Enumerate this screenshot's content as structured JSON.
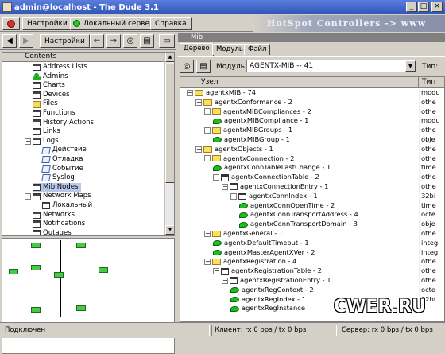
{
  "window": {
    "title": "admin@localhost - The Dude 3.1",
    "min": "_",
    "max": "□",
    "close": "×"
  },
  "menubar": {
    "settings": "Настройки",
    "local_server": "Локальный сервер",
    "help": "Справка",
    "brand": "HotSpot Controllers -> www"
  },
  "left_toolbar": {
    "settings": "Настройки"
  },
  "contents": {
    "header": "Contents",
    "items": [
      {
        "label": "Address Lists",
        "icon": "grid",
        "indent": 1
      },
      {
        "label": "Admins",
        "icon": "man",
        "indent": 1
      },
      {
        "label": "Charts",
        "icon": "grid",
        "indent": 1
      },
      {
        "label": "Devices",
        "icon": "grid",
        "indent": 1
      },
      {
        "label": "Files",
        "icon": "fold",
        "indent": 1
      },
      {
        "label": "Functions",
        "icon": "grid",
        "indent": 1
      },
      {
        "label": "History Actions",
        "icon": "grid",
        "indent": 1
      },
      {
        "label": "Links",
        "icon": "grid",
        "indent": 1
      },
      {
        "label": "Logs",
        "icon": "grid",
        "indent": 0,
        "toggle": "−"
      },
      {
        "label": "Действие",
        "icon": "note",
        "indent": 2
      },
      {
        "label": "Отладка",
        "icon": "note",
        "indent": 2
      },
      {
        "label": "Событие",
        "icon": "note",
        "indent": 2
      },
      {
        "label": "Syslog",
        "icon": "note",
        "indent": 2
      },
      {
        "label": "Mib Nodes",
        "icon": "grid",
        "indent": 1,
        "selected": true
      },
      {
        "label": "Network Maps",
        "icon": "grid",
        "indent": 0,
        "toggle": "−"
      },
      {
        "label": "Локальный",
        "icon": "grid",
        "indent": 2
      },
      {
        "label": "Networks",
        "icon": "grid",
        "indent": 1
      },
      {
        "label": "Notifications",
        "icon": "grid",
        "indent": 1
      },
      {
        "label": "Outages",
        "icon": "grid",
        "indent": 1
      }
    ]
  },
  "mib": {
    "header": "Mib",
    "tabs": [
      "Дерево",
      "Модуль",
      "Файл"
    ],
    "module_label": "Модуль:",
    "module_value": "AGENTX-MIB -- 41",
    "type_label": "Тип:",
    "col_node": "Узел",
    "col_type": "Тип",
    "rows": [
      {
        "name": "agentxMIB - 74",
        "icon": "folder",
        "level": 0,
        "type": "modu"
      },
      {
        "name": "agentxConformance - 2",
        "icon": "folder",
        "level": 1,
        "type": "othe"
      },
      {
        "name": "agentxMIBCompliances - 2",
        "icon": "folder",
        "level": 2,
        "type": "othe"
      },
      {
        "name": "agentxMIBCompliance - 1",
        "icon": "leaf",
        "level": 3,
        "type": "modu"
      },
      {
        "name": "agentxMIBGroups - 1",
        "icon": "folder",
        "level": 2,
        "type": "othe"
      },
      {
        "name": "agentxMIBGroup - 1",
        "icon": "leaf",
        "level": 3,
        "type": "obje"
      },
      {
        "name": "agentxObjects - 1",
        "icon": "folder",
        "level": 1,
        "type": "othe"
      },
      {
        "name": "agentxConnection - 2",
        "icon": "folder",
        "level": 2,
        "type": "othe"
      },
      {
        "name": "agentxConnTableLastChange - 1",
        "icon": "leaf",
        "level": 3,
        "type": "time"
      },
      {
        "name": "agentxConnectionTable - 2",
        "icon": "table",
        "level": 3,
        "type": "othe"
      },
      {
        "name": "agentxConnectionEntry - 1",
        "icon": "table",
        "level": 4,
        "type": "othe"
      },
      {
        "name": "agentxConnIndex - 1",
        "icon": "table",
        "level": 5,
        "type": "32bi"
      },
      {
        "name": "agentxConnOpenTime - 2",
        "icon": "leaf",
        "level": 6,
        "type": "time"
      },
      {
        "name": "agentxConnTransportAddress - 4",
        "icon": "leaf",
        "level": 6,
        "type": "octe"
      },
      {
        "name": "agentxConnTransportDomain - 3",
        "icon": "leaf",
        "level": 6,
        "type": "obje"
      },
      {
        "name": "agentxGeneral - 1",
        "icon": "folder",
        "level": 2,
        "type": "othe"
      },
      {
        "name": "agentxDefaultTimeout - 1",
        "icon": "leaf",
        "level": 3,
        "type": "integ"
      },
      {
        "name": "agentxMasterAgentXVer - 2",
        "icon": "leaf",
        "level": 3,
        "type": "integ"
      },
      {
        "name": "agentxRegistration - 4",
        "icon": "folder",
        "level": 2,
        "type": "othe"
      },
      {
        "name": "agentxRegistrationTable - 2",
        "icon": "table",
        "level": 3,
        "type": "othe"
      },
      {
        "name": "agentxRegistrationEntry - 1",
        "icon": "table",
        "level": 4,
        "type": "othe"
      },
      {
        "name": "agentxRegContext - 2",
        "icon": "leaf",
        "level": 5,
        "type": "octe"
      },
      {
        "name": "agentxRegIndex - 1",
        "icon": "leaf",
        "level": 5,
        "type": "32bi"
      },
      {
        "name": "agentxRegInstance",
        "icon": "leaf",
        "level": 5,
        "type": ""
      }
    ]
  },
  "status": {
    "connection": "Подключен",
    "client": "Клиент: rx 0 bps / tx 0 bps",
    "server": "Сервер: rx 0 bps / tx 0 bps"
  },
  "watermark": "CWER.RU"
}
